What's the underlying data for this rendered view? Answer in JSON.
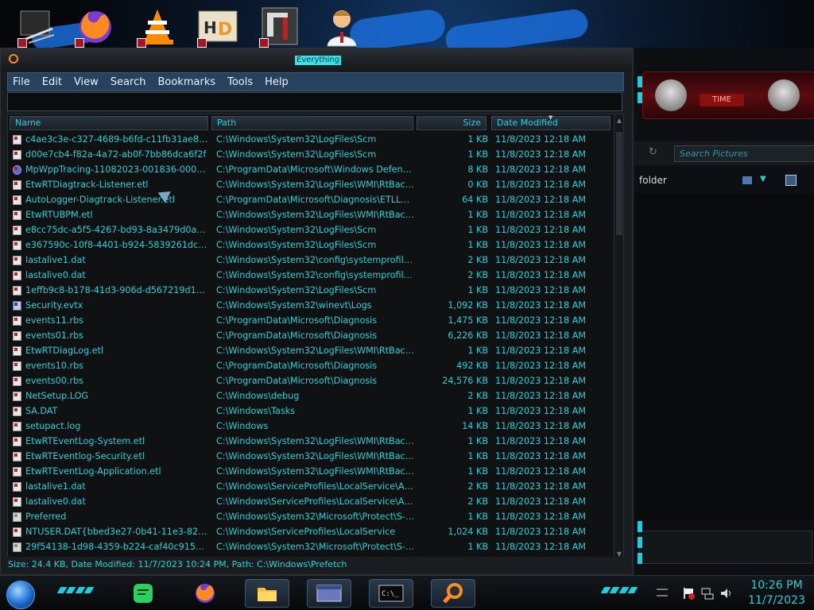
{
  "window": {
    "title": "Everything"
  },
  "menu": [
    "File",
    "Edit",
    "View",
    "Search",
    "Bookmarks",
    "Tools",
    "Help"
  ],
  "search": {
    "value": ""
  },
  "columns": {
    "name": "Name",
    "path": "Path",
    "size": "Size",
    "date": "Date Modified"
  },
  "rows": [
    {
      "name": "c4ae3c3e-c327-4689-b6fd-c11fb31ae88b",
      "path": "C:\\Windows\\System32\\LogFiles\\Scm",
      "size": "1 KB",
      "date": "11/8/2023 12:18 AM",
      "icon": "file"
    },
    {
      "name": "d00e7cb4-f82a-4a72-ab0f-7bb86dca6f2f",
      "path": "C:\\Windows\\System32\\LogFiles\\Scm",
      "size": "1 KB",
      "date": "11/8/2023 12:18 AM",
      "icon": "file"
    },
    {
      "name": "MpWppTracing-11082023-001836-00000003-...",
      "path": "C:\\ProgramData\\Microsoft\\Windows Defender\\...",
      "size": "8 KB",
      "date": "11/8/2023 12:18 AM",
      "icon": "shield"
    },
    {
      "name": "EtwRTDiagtrack-Listener.etl",
      "path": "C:\\Windows\\System32\\LogFiles\\WMI\\RtBackup",
      "size": "0 KB",
      "date": "11/8/2023 12:18 AM",
      "icon": "file"
    },
    {
      "name": "AutoLogger-Diagtrack-Listener.etl",
      "path": "C:\\ProgramData\\Microsoft\\Diagnosis\\ETLLogs\\...",
      "size": "64 KB",
      "date": "11/8/2023 12:18 AM",
      "icon": "file"
    },
    {
      "name": "EtwRTUBPM.etl",
      "path": "C:\\Windows\\System32\\LogFiles\\WMI\\RtBackup",
      "size": "1 KB",
      "date": "11/8/2023 12:18 AM",
      "icon": "file"
    },
    {
      "name": "e8cc75dc-a5f5-4267-bd93-8a3479d0a822",
      "path": "C:\\Windows\\System32\\LogFiles\\Scm",
      "size": "1 KB",
      "date": "11/8/2023 12:18 AM",
      "icon": "file"
    },
    {
      "name": "e367590c-10f8-4401-b924-5839261dc94e",
      "path": "C:\\Windows\\System32\\LogFiles\\Scm",
      "size": "1 KB",
      "date": "11/8/2023 12:18 AM",
      "icon": "file"
    },
    {
      "name": "lastalive1.dat",
      "path": "C:\\Windows\\System32\\config\\systemprofile\\Ap...",
      "size": "2 KB",
      "date": "11/8/2023 12:18 AM",
      "icon": "file"
    },
    {
      "name": "lastalive0.dat",
      "path": "C:\\Windows\\System32\\config\\systemprofile\\Ap...",
      "size": "2 KB",
      "date": "11/8/2023 12:18 AM",
      "icon": "file"
    },
    {
      "name": "1effb9c8-b178-41d3-906d-d567219d1b46",
      "path": "C:\\Windows\\System32\\LogFiles\\Scm",
      "size": "1 KB",
      "date": "11/8/2023 12:18 AM",
      "icon": "file"
    },
    {
      "name": "Security.evtx",
      "path": "C:\\Windows\\System32\\winevt\\Logs",
      "size": "1,092 KB",
      "date": "11/8/2023 12:18 AM",
      "icon": "evtx"
    },
    {
      "name": "events11.rbs",
      "path": "C:\\ProgramData\\Microsoft\\Diagnosis",
      "size": "1,475 KB",
      "date": "11/8/2023 12:18 AM",
      "icon": "file"
    },
    {
      "name": "events01.rbs",
      "path": "C:\\ProgramData\\Microsoft\\Diagnosis",
      "size": "6,226 KB",
      "date": "11/8/2023 12:18 AM",
      "icon": "file"
    },
    {
      "name": "EtwRTDiagLog.etl",
      "path": "C:\\Windows\\System32\\LogFiles\\WMI\\RtBackup",
      "size": "1 KB",
      "date": "11/8/2023 12:18 AM",
      "icon": "file"
    },
    {
      "name": "events10.rbs",
      "path": "C:\\ProgramData\\Microsoft\\Diagnosis",
      "size": "492 KB",
      "date": "11/8/2023 12:18 AM",
      "icon": "file"
    },
    {
      "name": "events00.rbs",
      "path": "C:\\ProgramData\\Microsoft\\Diagnosis",
      "size": "24,576 KB",
      "date": "11/8/2023 12:18 AM",
      "icon": "file"
    },
    {
      "name": "NetSetup.LOG",
      "path": "C:\\Windows\\debug",
      "size": "2 KB",
      "date": "11/8/2023 12:18 AM",
      "icon": "file"
    },
    {
      "name": "SA.DAT",
      "path": "C:\\Windows\\Tasks",
      "size": "1 KB",
      "date": "11/8/2023 12:18 AM",
      "icon": "file"
    },
    {
      "name": "setupact.log",
      "path": "C:\\Windows",
      "size": "14 KB",
      "date": "11/8/2023 12:18 AM",
      "icon": "file"
    },
    {
      "name": "EtwRTEventLog-System.etl",
      "path": "C:\\Windows\\System32\\LogFiles\\WMI\\RtBackup",
      "size": "1 KB",
      "date": "11/8/2023 12:18 AM",
      "icon": "file"
    },
    {
      "name": "EtwRTEventlog-Security.etl",
      "path": "C:\\Windows\\System32\\LogFiles\\WMI\\RtBackup",
      "size": "1 KB",
      "date": "11/8/2023 12:18 AM",
      "icon": "file"
    },
    {
      "name": "EtwRTEventLog-Application.etl",
      "path": "C:\\Windows\\System32\\LogFiles\\WMI\\RtBackup",
      "size": "1 KB",
      "date": "11/8/2023 12:18 AM",
      "icon": "file"
    },
    {
      "name": "lastalive1.dat",
      "path": "C:\\Windows\\ServiceProfiles\\LocalService\\AppDa...",
      "size": "2 KB",
      "date": "11/8/2023 12:18 AM",
      "icon": "file"
    },
    {
      "name": "lastalive0.dat",
      "path": "C:\\Windows\\ServiceProfiles\\LocalService\\AppDa...",
      "size": "2 KB",
      "date": "11/8/2023 12:18 AM",
      "icon": "file"
    },
    {
      "name": "Preferred",
      "path": "C:\\Windows\\System32\\Microsoft\\Protect\\S-1-5-...",
      "size": "1 KB",
      "date": "11/8/2023 12:18 AM",
      "icon": "pref"
    },
    {
      "name": "NTUSER.DAT{bbed3e27-0b41-11e3-8249-d6...",
      "path": "C:\\Windows\\ServiceProfiles\\LocalService",
      "size": "1,024 KB",
      "date": "11/8/2023 12:18 AM",
      "icon": "file"
    },
    {
      "name": "29f54138-1d98-4359-b224-caf40c915a5c",
      "path": "C:\\Windows\\System32\\Microsoft\\Protect\\S-1-5-...",
      "size": "1 KB",
      "date": "11/8/2023 12:18 AM",
      "icon": "pref"
    }
  ],
  "status": {
    "text": "Size: 24.4 KB, Date Modified: 11/7/2023 10:24 PM, Path: C:\\Windows\\Prefetch"
  },
  "background_window": {
    "search_placeholder": "Search Pictures",
    "folder_label": "folder",
    "banner_label": "TIME"
  },
  "clock": {
    "time": "10:26 PM",
    "date": "11/7/2023"
  },
  "colors": {
    "accent": "#2ad0d8",
    "menubar": "#26425e",
    "background": "#0f1113"
  }
}
